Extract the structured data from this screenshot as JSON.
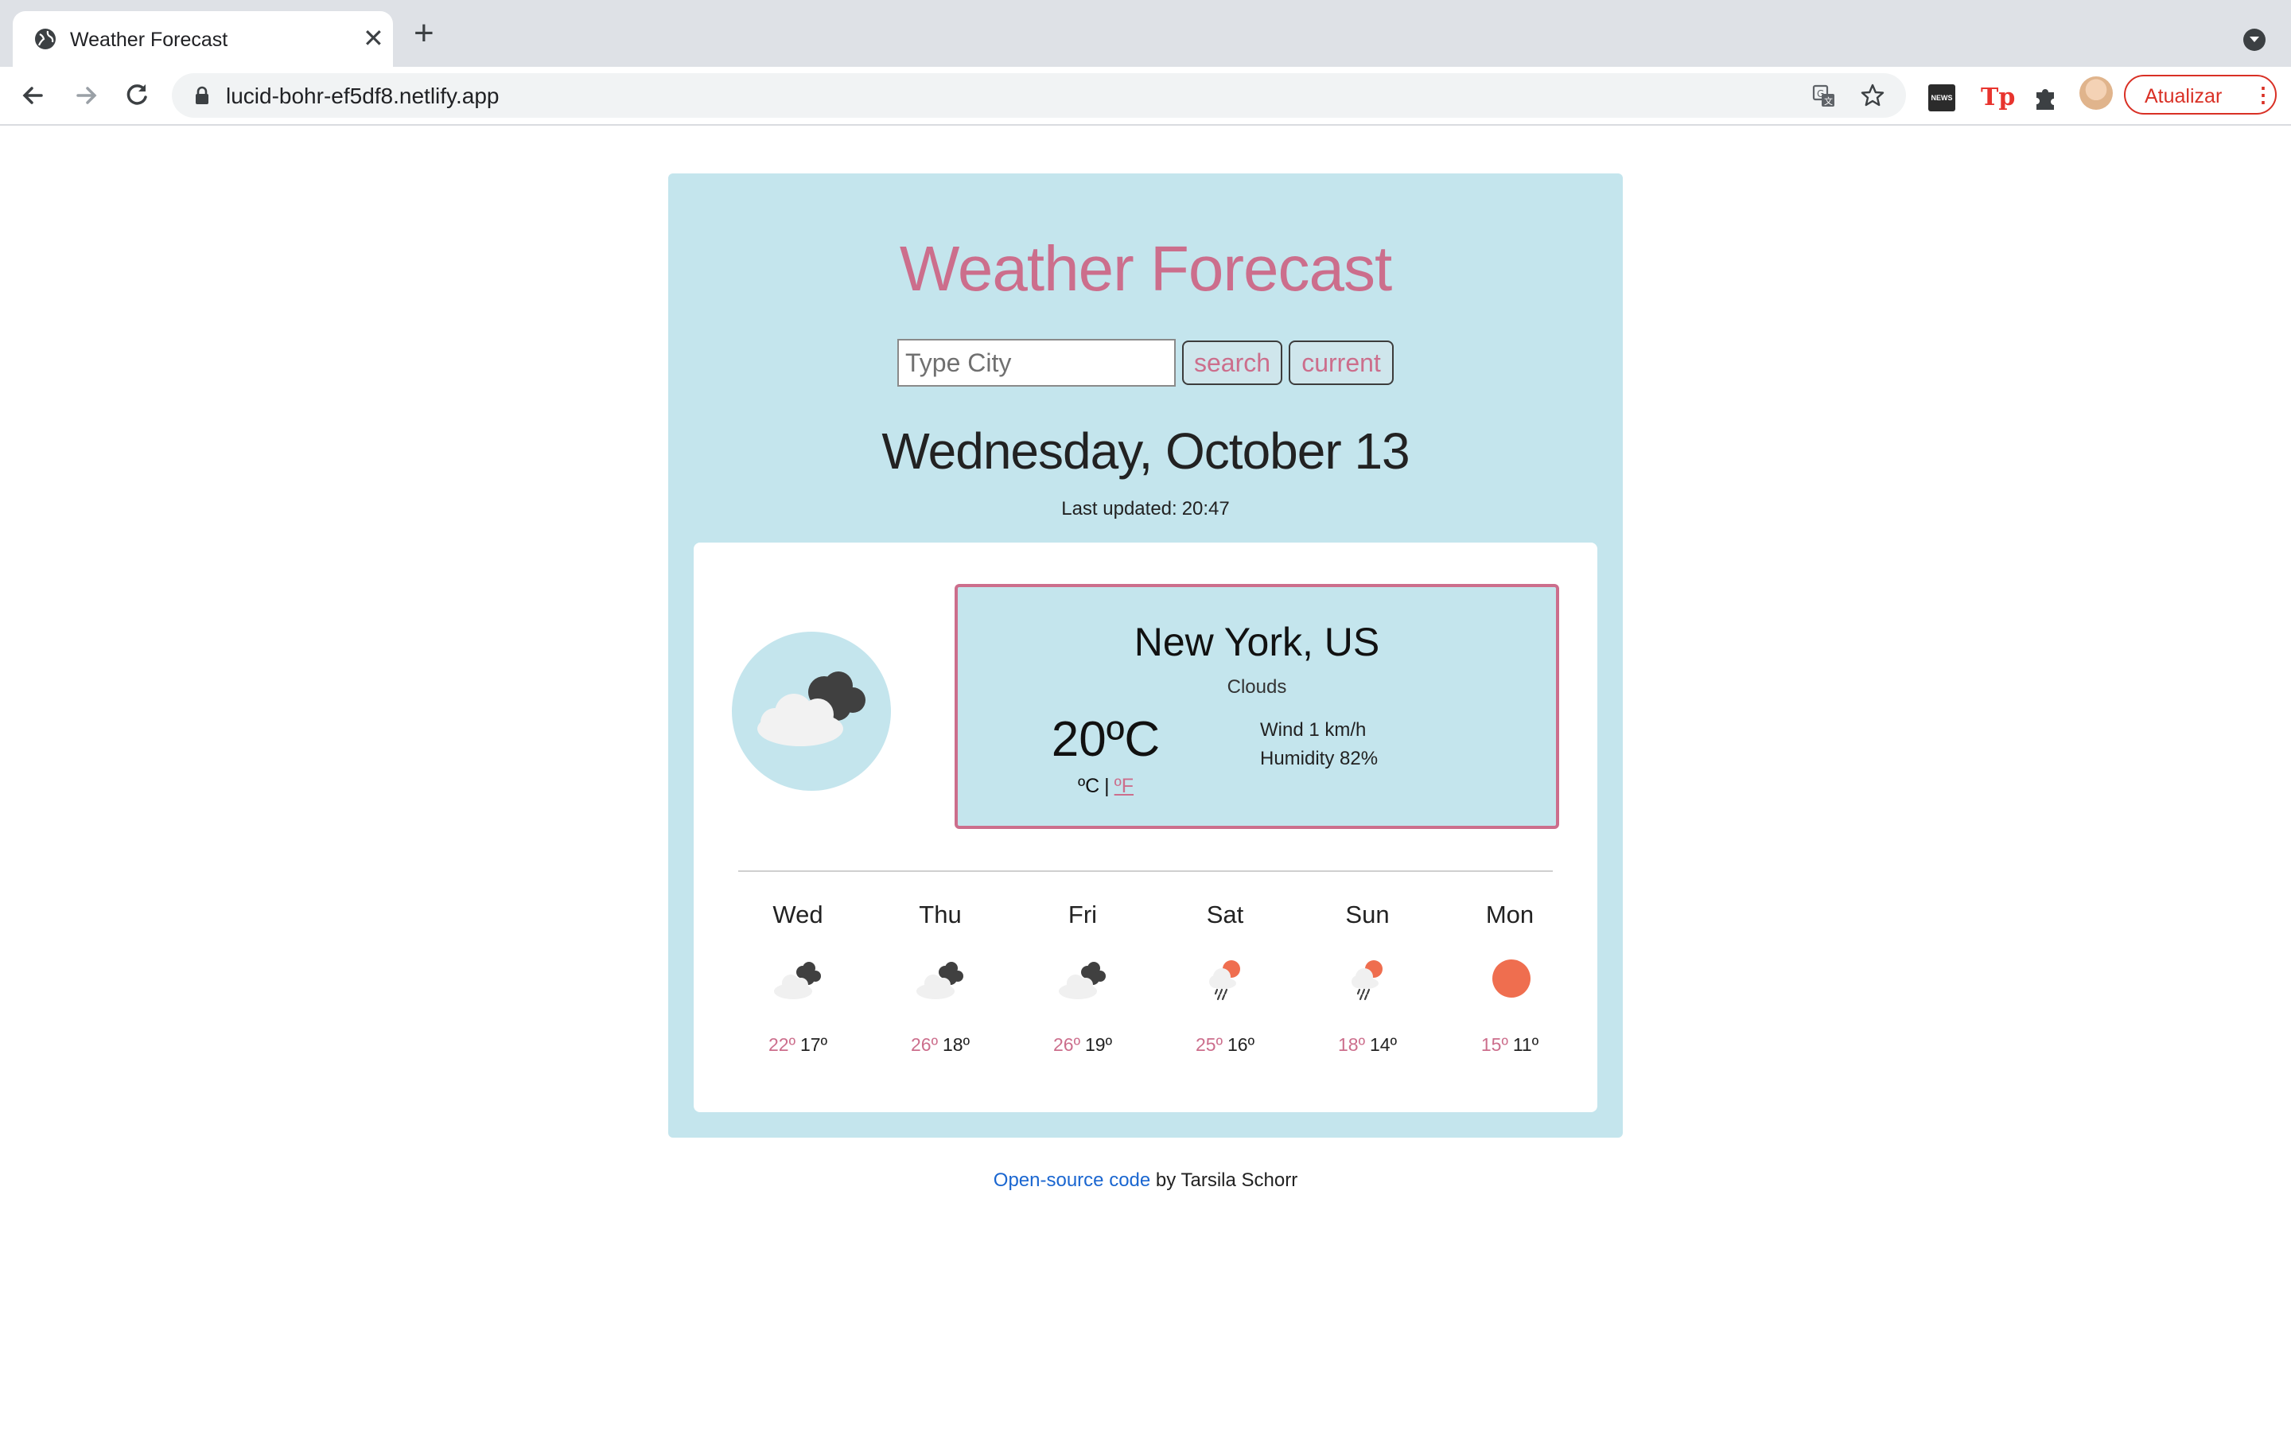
{
  "browser": {
    "tab_title": "Weather Forecast",
    "url": "lucid-bohr-ef5df8.netlify.app",
    "update_label": "Atualizar",
    "extension_news_label": "NEWS"
  },
  "app": {
    "title": "Weather Forecast",
    "search_placeholder": "Type City",
    "search_label": "search",
    "current_label": "current",
    "date": "Wednesday, October 13",
    "last_updated_label": "Last updated:",
    "last_updated_time": "20:47",
    "accent_color": "#cc6e8c",
    "panel_color": "#c4e5ed"
  },
  "current": {
    "city": "New York, US",
    "description": "Clouds",
    "temperature": "20ºC",
    "unit_c": "ºC",
    "unit_sep": "|",
    "unit_f": "ºF",
    "wind": "Wind 1 km/h",
    "humidity": "Humidity 82%",
    "icon": "clouds-icon"
  },
  "forecast": [
    {
      "day": "Wed",
      "max": "22º",
      "min": "17º",
      "icon": "clouds-icon"
    },
    {
      "day": "Thu",
      "max": "26º",
      "min": "18º",
      "icon": "clouds-icon"
    },
    {
      "day": "Fri",
      "max": "26º",
      "min": "19º",
      "icon": "clouds-icon"
    },
    {
      "day": "Sat",
      "max": "25º",
      "min": "16º",
      "icon": "sun-rain-icon"
    },
    {
      "day": "Sun",
      "max": "18º",
      "min": "14º",
      "icon": "sun-rain-icon"
    },
    {
      "day": "Mon",
      "max": "15º",
      "min": "11º",
      "icon": "sun-icon"
    }
  ],
  "footer": {
    "link_text": "Open-source code",
    "suffix": "by Tarsila Schorr"
  }
}
